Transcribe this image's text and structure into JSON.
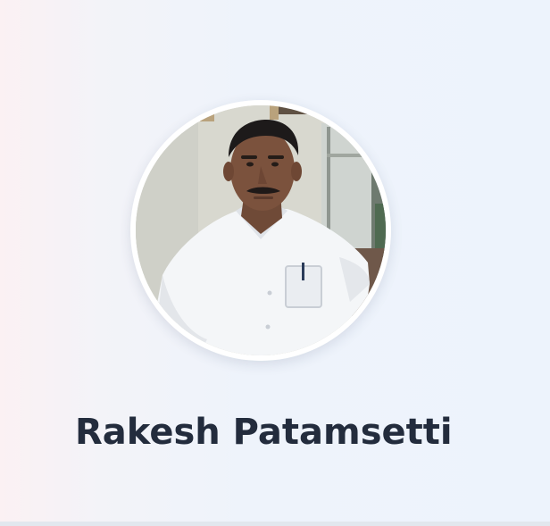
{
  "profile": {
    "name": "Rakesh Patamsetti",
    "avatar_icon": "profile-photo"
  },
  "colors": {
    "name_text": "#232c3d",
    "avatar_ring": "#ffffff",
    "background": "#edf3fc"
  }
}
